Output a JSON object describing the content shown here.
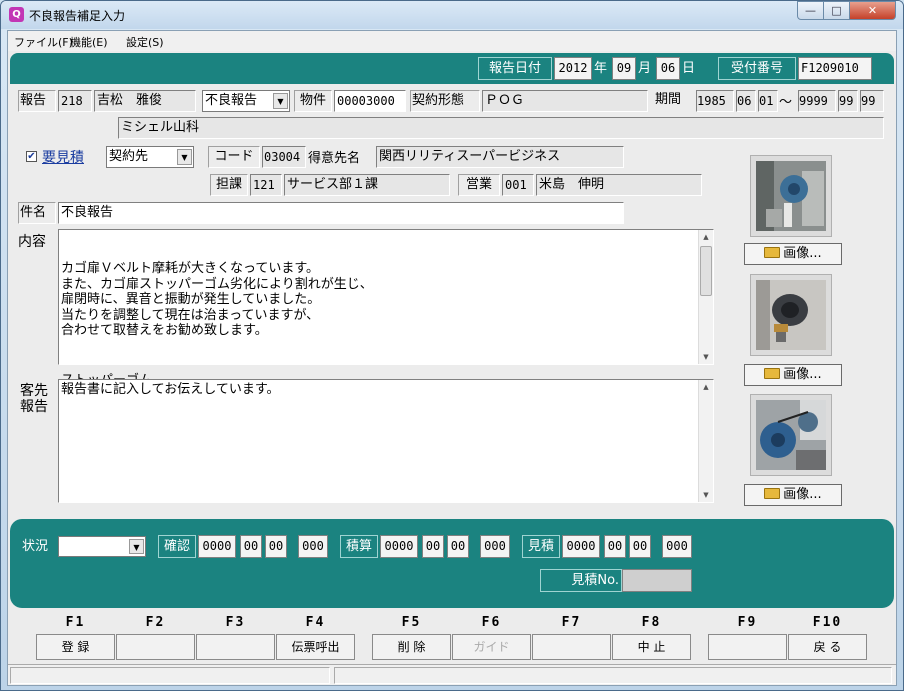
{
  "window": {
    "title": "不良報告補足入力",
    "app_icon_glyph": "Q",
    "buttons": {
      "minimize": "—",
      "maximize": "□",
      "close": "✕"
    }
  },
  "menu": [
    "ファイル(F)",
    "機能(E)",
    "設定(S)"
  ],
  "header": {
    "report_date_label": "報告日付",
    "year": "2012",
    "year_unit": "年",
    "month": "09",
    "month_unit": "月",
    "day": "06",
    "day_unit": "日",
    "receipt_label": "受付番号",
    "receipt_no": "F1209010"
  },
  "report": {
    "label": "報告",
    "code": "218",
    "staff_name": "吉松　雅俊",
    "type_select": "不良報告",
    "property_label": "物件",
    "property_no": "00003000",
    "contract_label": "契約形態",
    "contract_value": "ＰＯＧ",
    "period_label": "期間",
    "period_from": [
      "1985",
      "06",
      "01"
    ],
    "period_sep": "～",
    "period_to": [
      "9999",
      "99",
      "99"
    ],
    "property_name": "ミシェル山科"
  },
  "estimate": {
    "checkbox_checked": true,
    "checkbox_mark": "✔",
    "label": "要見積",
    "party_select": "契約先",
    "code_label": "コード",
    "code": "03004",
    "customer_label": "得意先名",
    "customer_name": "関西リリティスーパービジネス",
    "section_label": "担課",
    "section_code": "121",
    "section_name": "サービス部１課",
    "sales_label": "営業",
    "sales_code": "001",
    "sales_name": "米島　伸明"
  },
  "subject": {
    "label": "件名",
    "value": "不良報告"
  },
  "content": {
    "label": "内容",
    "lines": [
      "カゴ扉Ｖベルト摩耗が大きくなっています。",
      "また、カゴ扉ストッパーゴム劣化により割れが生じ、",
      "扉閉時に、異音と振動が発生していました。",
      "当たりを調整して現在は治まっていますが、",
      "合わせて取替えをお勧め致します。",
      "",
      "",
      "ストッパーゴム"
    ]
  },
  "customer_report": {
    "label_line1": "客先",
    "label_line2": "報告",
    "text": "報告書に記入してお伝えしています。"
  },
  "images": {
    "button_label": "画像..."
  },
  "status": {
    "label": "状況",
    "select_value": "",
    "confirm_label": "確認",
    "confirm": [
      "0000",
      "00",
      "00",
      "000"
    ],
    "calc_label": "積算",
    "calc": [
      "0000",
      "00",
      "00",
      "000"
    ],
    "estimate_label": "見積",
    "estimate": [
      "0000",
      "00",
      "00",
      "000"
    ],
    "estimate_no_label": "見積No.",
    "estimate_no": ""
  },
  "fkeys": [
    {
      "key": "F1",
      "label": "登 録",
      "enabled": true
    },
    {
      "key": "F2",
      "label": "",
      "enabled": true
    },
    {
      "key": "F3",
      "label": "",
      "enabled": true
    },
    {
      "key": "F4",
      "label": "伝票呼出",
      "enabled": true
    },
    {
      "key": "F5",
      "label": "削 除",
      "enabled": true
    },
    {
      "key": "F6",
      "label": "ガイド",
      "enabled": false
    },
    {
      "key": "F7",
      "label": "",
      "enabled": true
    },
    {
      "key": "F8",
      "label": "中 止",
      "enabled": true
    },
    {
      "key": "F9",
      "label": "",
      "enabled": true
    },
    {
      "key": "F10",
      "label": "戻 る",
      "enabled": true
    }
  ],
  "colors": {
    "accent_teal": "#1b8380",
    "link_blue": "#1a3ca0"
  }
}
